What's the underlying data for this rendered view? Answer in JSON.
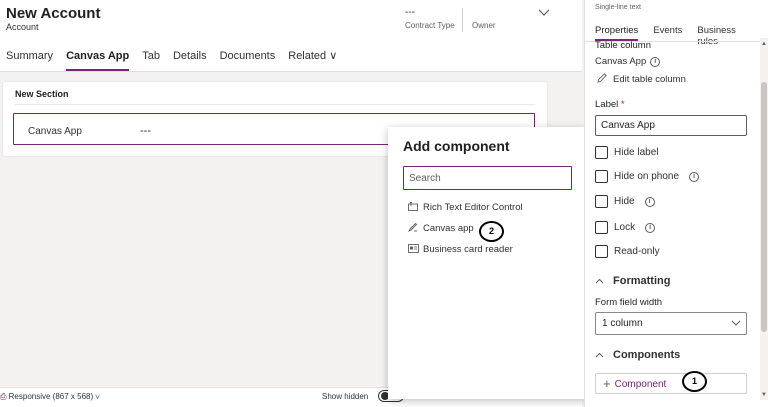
{
  "form": {
    "title": "New Account",
    "entity": "Account",
    "header_fields": [
      {
        "value": "---",
        "label": "Contract Type"
      },
      {
        "value": "",
        "label": "Owner"
      }
    ],
    "tabs": [
      "Summary",
      "Canvas App",
      "Tab",
      "Details",
      "Documents",
      "Related ∨"
    ],
    "active_tab": "Canvas App",
    "section": {
      "title": "New Section",
      "field_label": "Canvas App",
      "field_value": "---"
    }
  },
  "status_bar": {
    "responsive": "Responsive (867 x 568) ∨",
    "show_hidden": "Show hidden"
  },
  "add_component": {
    "title": "Add component",
    "search_placeholder": "Search",
    "items": [
      {
        "icon": "rich-text-icon",
        "label": "Rich Text Editor Control"
      },
      {
        "icon": "canvas-app-icon",
        "label": "Canvas app"
      },
      {
        "icon": "business-card-icon",
        "label": "Business card reader"
      }
    ]
  },
  "properties_pane": {
    "subtitle": "Single-line text",
    "tabs": [
      "Properties",
      "Events",
      "Business rules"
    ],
    "active_tab": "Properties",
    "table_column_heading": "Table column",
    "table_column_name": "Canvas App",
    "edit_table_column": "Edit table column",
    "label_heading": "Label",
    "required_marker": "*",
    "label_value": "Canvas App",
    "checkboxes": [
      {
        "label": "Hide label",
        "info": false
      },
      {
        "label": "Hide on phone",
        "info": true
      },
      {
        "label": "Hide",
        "info": true
      },
      {
        "label": "Lock",
        "info": true
      },
      {
        "label": "Read-only",
        "info": false
      }
    ],
    "formatting_heading": "Formatting",
    "form_field_width_label": "Form field width",
    "form_field_width_value": "1 column",
    "components_heading": "Components",
    "component_button": "Component"
  },
  "callouts": [
    "1",
    "2"
  ],
  "colors": {
    "accent": "#742774",
    "required": "#a4262c"
  }
}
